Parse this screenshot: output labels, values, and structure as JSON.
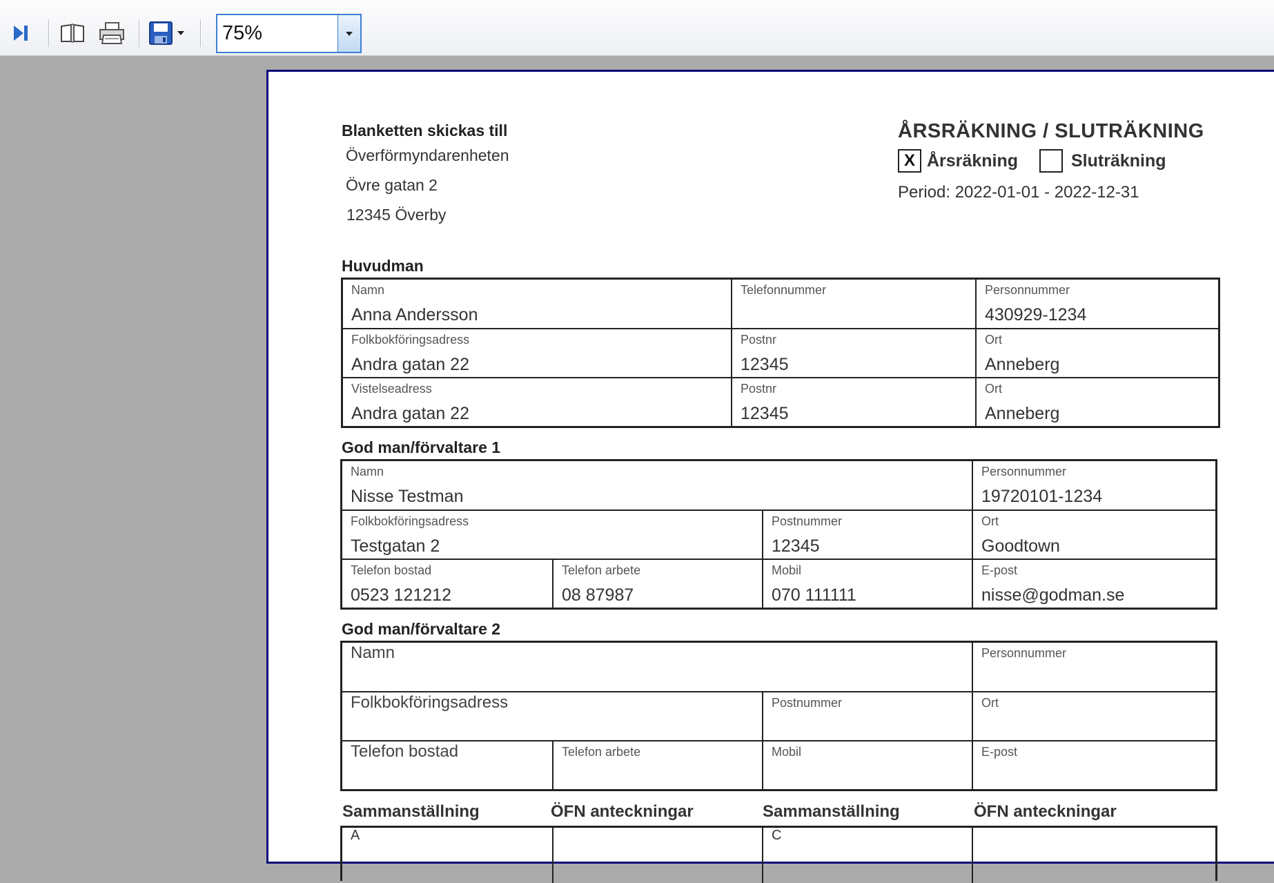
{
  "toolbar": {
    "icons": [
      "last-page-icon",
      "page-setup-icon",
      "print-icon",
      "save-icon"
    ],
    "zoom_value": "75%"
  },
  "page": {
    "sender": {
      "heading": "Blanketten skickas till",
      "lines": [
        "Överförmyndarenheten",
        "Övre gatan 2",
        "12345 Överby"
      ]
    },
    "doc": {
      "title": "ÅRSRÄKNING / SLUTRÄKNING",
      "check_annual_mark": "X",
      "check_annual_label": "Årsräkning",
      "check_final_mark": "",
      "check_final_label": "Sluträkning",
      "period": "Period: 2022-01-01 - 2022-12-31"
    },
    "huvudman": {
      "heading": "Huvudman",
      "name_label": "Namn",
      "name": "Anna Andersson",
      "phone_label": "Telefonnummer",
      "phone": "",
      "pnr_label": "Personnummer",
      "pnr": "430929-1234",
      "addr_label": "Folkbokföringsadress",
      "addr": "Andra gatan 22",
      "zip_label": "Postnr",
      "zip": "12345",
      "city_label": "Ort",
      "city": "Anneberg",
      "stay_label": "Vistelseadress",
      "stay": "Andra gatan 22",
      "stay_zip_label": "Postnr",
      "stay_zip": "12345",
      "stay_city_label": "Ort",
      "stay_city": "Anneberg"
    },
    "gm1": {
      "heading": "God man/förvaltare 1",
      "name_label": "Namn",
      "name": "Nisse Testman",
      "pnr_label": "Personnummer",
      "pnr": "19720101-1234",
      "addr_label": "Folkbokföringsadress",
      "addr": "Testgatan 2",
      "zip_label": "Postnummer",
      "zip": "12345",
      "city_label": "Ort",
      "city": "Goodtown",
      "home_label": "Telefon bostad",
      "home": "0523 121212",
      "work_label": "Telefon arbete",
      "work": "08 87987",
      "mobile_label": "Mobil",
      "mobile": "070 111111",
      "email_label": "E-post",
      "email": "nisse@godman.se"
    },
    "gm2": {
      "heading": "God man/förvaltare 2",
      "name_label": "Namn",
      "pnr_label": "Personnummer",
      "addr_label": "Folkbokföringsadress",
      "zip_label": "Postnummer",
      "city_label": "Ort",
      "home_label": "Telefon bostad",
      "work_label": "Telefon arbete",
      "mobile_label": "Mobil",
      "email_label": "E-post"
    },
    "summary": {
      "h1": "Sammanställning",
      "h2": "ÖFN  anteckningar",
      "h3": "Sammanställning",
      "h4": "ÖFN  anteckningar",
      "row_a": "A",
      "row_c": "C"
    }
  }
}
